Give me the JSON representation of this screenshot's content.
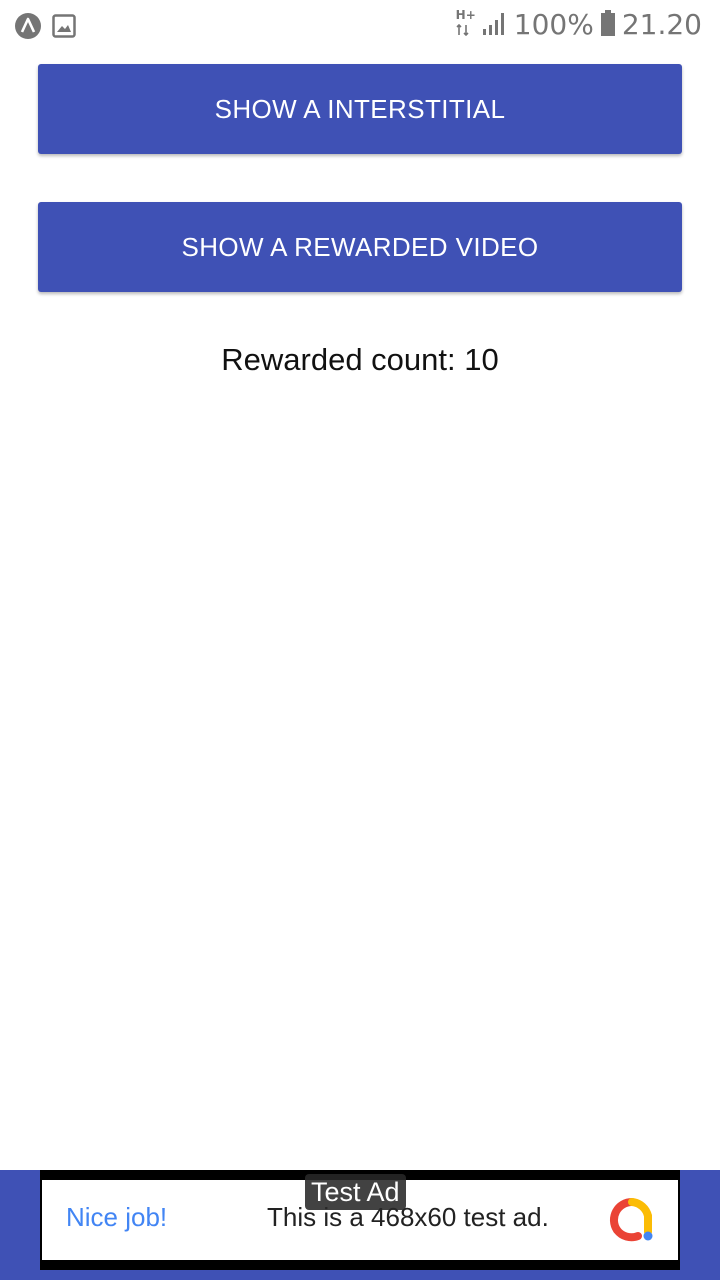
{
  "status_bar": {
    "network_type": "H+",
    "battery_percent": "100%",
    "time": "21.20",
    "icons": [
      "app-notification-icon",
      "image-notification-icon",
      "data-arrows-icon",
      "signal-icon",
      "battery-icon"
    ]
  },
  "actions": {
    "interstitial_label": "SHOW A INTERSTITIAL",
    "rewarded_label": "SHOW A REWARDED VIDEO"
  },
  "reward": {
    "count_text": "Rewarded count: 10"
  },
  "ad": {
    "badge": "Test Ad",
    "headline": "Nice job!",
    "description": "This is a 468x60 test ad."
  },
  "colors": {
    "primary": "#3f51b5",
    "ad_headline": "#4285f4"
  }
}
